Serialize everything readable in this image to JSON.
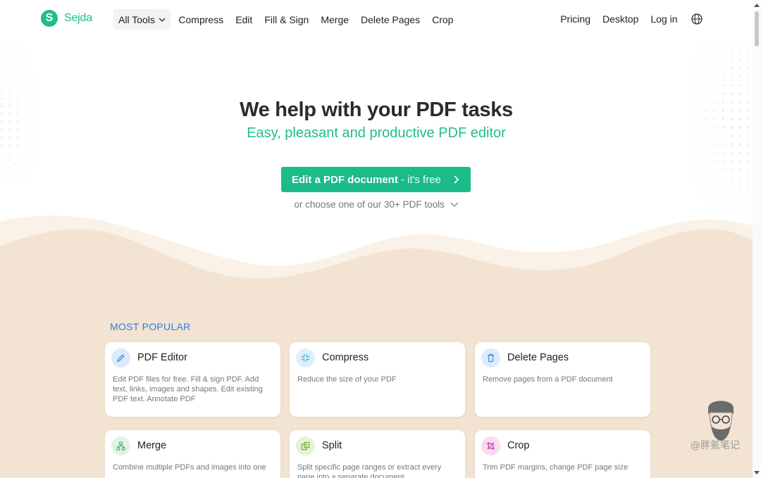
{
  "brand": {
    "name": "Sejda",
    "logo_letter": "S",
    "color": "#1fbd8c"
  },
  "nav": {
    "all_tools": "All Tools",
    "items": [
      "Compress",
      "Edit",
      "Fill & Sign",
      "Merge",
      "Delete Pages",
      "Crop"
    ],
    "right": {
      "pricing": "Pricing",
      "desktop": "Desktop",
      "login": "Log in",
      "language_icon": "globe-icon"
    }
  },
  "hero": {
    "title": "We help with your PDF tasks",
    "subtitle": "Easy, pleasant and productive PDF editor",
    "cta_main": "Edit a PDF document",
    "cta_free": "- it's free",
    "choose": "or choose one of our 30+ PDF tools"
  },
  "popular": {
    "label": "MOST POPULAR",
    "cards": [
      {
        "title": "PDF Editor",
        "desc": "Edit PDF files for free. Fill & sign PDF. Add text, links, images and shapes. Edit existing PDF text. Annotate PDF",
        "icon": "pencil-icon",
        "icon_bg": "#dcebfb",
        "icon_color": "#3a86d8"
      },
      {
        "title": "Compress",
        "desc": "Reduce the size of your PDF",
        "icon": "compress-icon",
        "icon_bg": "#ddf0f8",
        "icon_color": "#3aa6cf"
      },
      {
        "title": "Delete Pages",
        "desc": "Remove pages from a PDF document",
        "icon": "trash-icon",
        "icon_bg": "#dcebfb",
        "icon_color": "#3a86d8"
      },
      {
        "title": "Merge",
        "desc": "Combine multiple PDFs and images into one",
        "icon": "merge-icon",
        "icon_bg": "#dff3e6",
        "icon_color": "#3daa63"
      },
      {
        "title": "Split",
        "desc": "Split specific page ranges or extract every page into a separate document",
        "icon": "split-icon",
        "icon_bg": "#e6f2d6",
        "icon_color": "#6aab35"
      },
      {
        "title": "Crop",
        "desc": "Trim PDF margins, change PDF page size",
        "icon": "crop-icon",
        "icon_bg": "#f8dcf2",
        "icon_color": "#c93aa8"
      }
    ]
  },
  "colors": {
    "accent": "#1fbd8c",
    "wave": "#f3e3d3",
    "wave_light": "#faf1e7",
    "label_blue": "#2b7de1"
  },
  "watermark": {
    "text": "@胖氪笔记"
  }
}
